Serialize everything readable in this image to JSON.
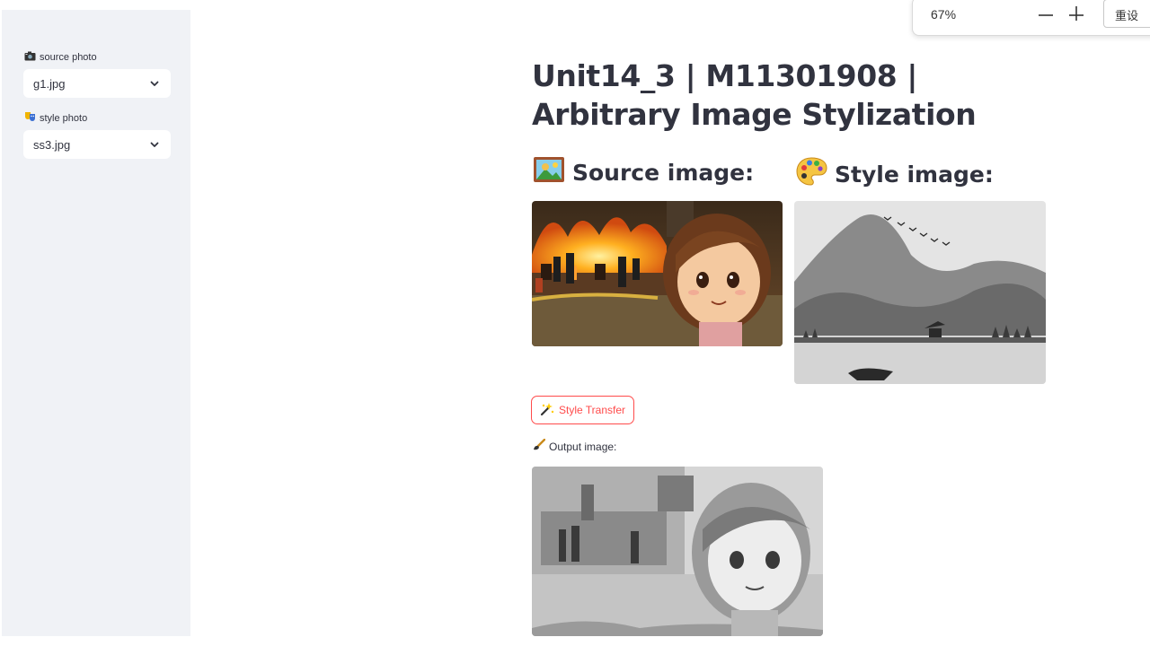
{
  "sidebar": {
    "source_label": "source photo",
    "source_value": "g1.jpg",
    "style_label": "style photo",
    "style_value": "ss3.jpg"
  },
  "zoom": {
    "level": "67%",
    "reset_label": "重设"
  },
  "main": {
    "title": "Unit14_3 | M11301908 | Arbitrary Image Stylization",
    "source_heading": "Source image:",
    "style_heading": "Style image:",
    "button_label": "Style Transfer",
    "output_label": "Output image:"
  },
  "colors": {
    "sidebar_bg": "#f0f2f6",
    "accent": "#ff4b4b",
    "text": "#31333f"
  },
  "icons": {
    "source_label": "camera-icon",
    "style_label": "art-mask-icon",
    "source_heading": "framed-picture-icon",
    "style_heading": "palette-icon",
    "button": "sparkle-wand-icon",
    "output": "paintbrush-icon"
  }
}
